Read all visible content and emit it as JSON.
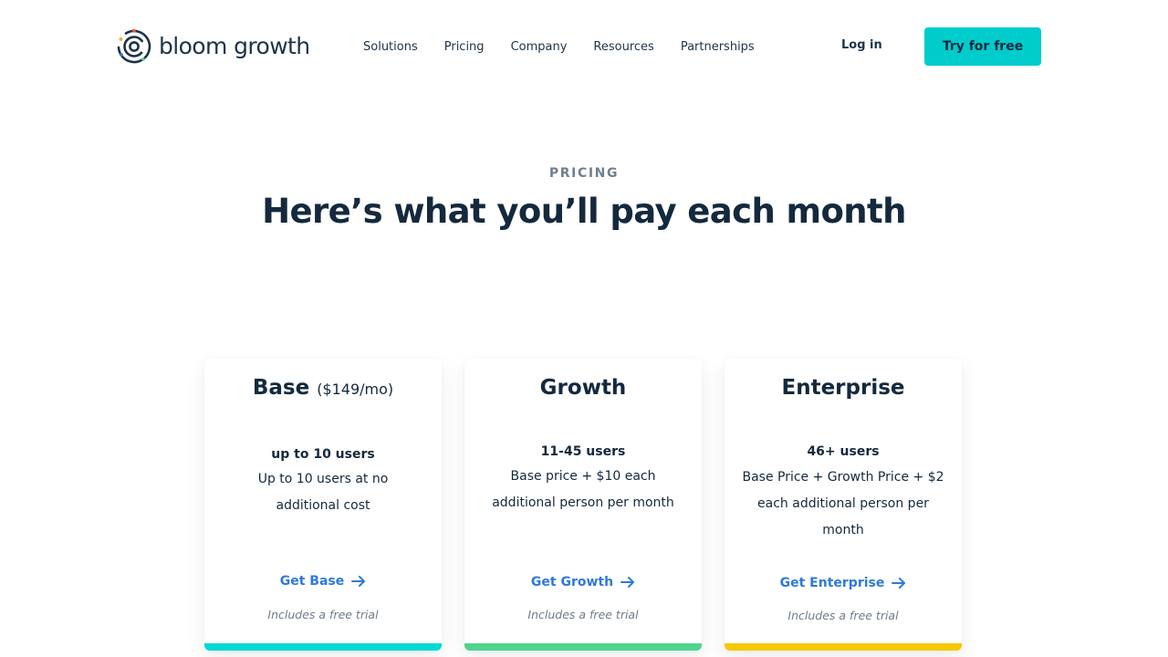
{
  "header": {
    "logo_text": "bloom growth",
    "nav": [
      {
        "label": "Solutions"
      },
      {
        "label": "Pricing"
      },
      {
        "label": "Company"
      },
      {
        "label": "Resources"
      },
      {
        "label": "Partnerships"
      }
    ],
    "login_label": "Log in",
    "cta_label": "Try for free"
  },
  "hero": {
    "eyebrow": "PRICING",
    "headline": "Here’s what you’ll pay each month"
  },
  "plans": [
    {
      "name": "Base",
      "price": "($149/mo)",
      "users": "up to 10 users",
      "description": "Up to 10 users at no additional cost",
      "link_label": "Get Base",
      "trial": "Includes a free trial",
      "accent_color": "#00d8d8"
    },
    {
      "name": "Growth",
      "users": "11-45 users",
      "description": "Base price + $10 each additional person per month",
      "link_label": "Get Growth",
      "trial": "Includes a free trial",
      "accent_color": "#4fd48c"
    },
    {
      "name": "Enterprise",
      "users": "46+ users",
      "description": "Base Price + Growth Price + $2 each additional person per month",
      "link_label": "Get Enterprise",
      "trial": "Includes a free trial",
      "accent_color": "#f5c800"
    }
  ],
  "colors": {
    "brand_dark": "#14293d",
    "cta": "#00cccc",
    "link": "#2f79d9"
  },
  "icons": {
    "logo": "bloom-spiral-logo-icon",
    "link_arrow": "arrow-right-icon"
  }
}
